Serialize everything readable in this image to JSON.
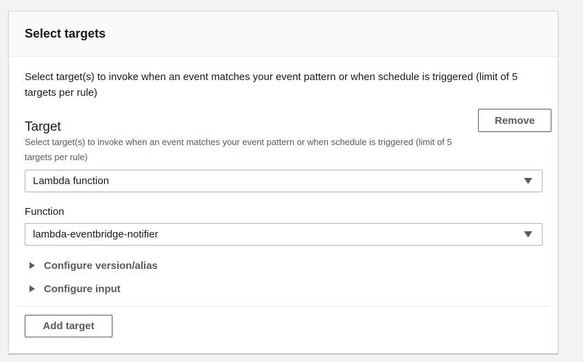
{
  "panel": {
    "title": "Select targets",
    "intro": "Select target(s) to invoke when an event matches your event pattern or when schedule is triggered (limit of 5 targets per rule)"
  },
  "target": {
    "label": "Target",
    "description": "Select target(s) to invoke when an event matches your event pattern or when schedule is triggered (limit of 5 targets per rule)",
    "remove_label": "Remove",
    "type_value": "Lambda function"
  },
  "function": {
    "label": "Function",
    "value": "lambda-eventbridge-notifier"
  },
  "expanders": [
    {
      "label": "Configure version/alias"
    },
    {
      "label": "Configure input"
    }
  ],
  "actions": {
    "add_target_label": "Add target"
  },
  "icons": {
    "dropdown": "caret-down-icon",
    "expander": "caret-right-icon"
  },
  "colors": {
    "page_bg": "#f2f3f3",
    "panel_bg": "#ffffff",
    "header_bg": "#fafafa",
    "text": "#16191f",
    "secondary_text": "#545b64",
    "border": "#aab7b8"
  }
}
